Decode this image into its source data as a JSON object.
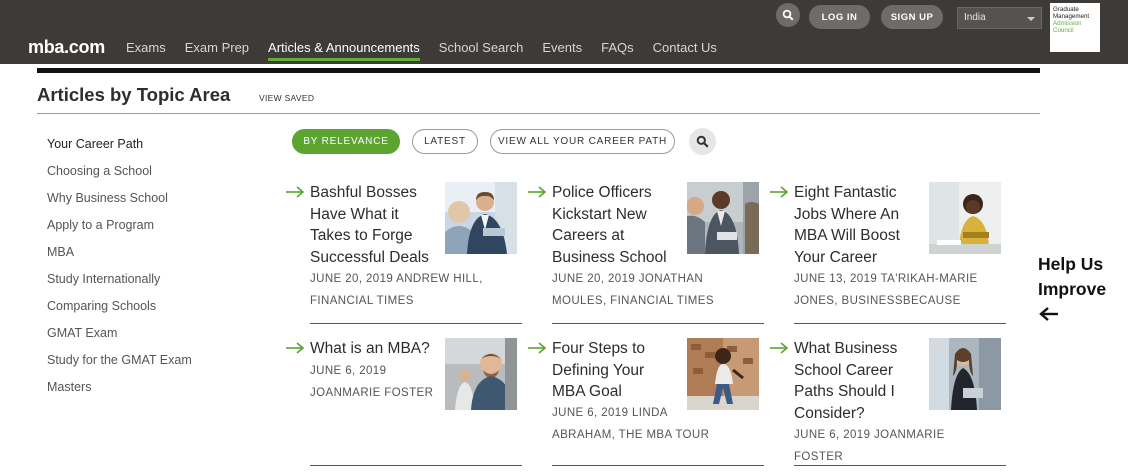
{
  "header": {
    "logo": "mba.com",
    "nav": [
      "Exams",
      "Exam Prep",
      "Articles & Announcements",
      "School Search",
      "Events",
      "FAQs",
      "Contact Us"
    ],
    "active_nav": "Articles & Announcements",
    "login_label": "LOG IN",
    "signup_label": "SIGN UP",
    "country_value": "India",
    "gmac_logo": {
      "line1": "Graduate",
      "line2": "Management",
      "line3": "Admission",
      "line4": "Council"
    }
  },
  "page": {
    "title": "Articles by Topic Area",
    "view_saved": "VIEW SAVED"
  },
  "sidebar": {
    "items": [
      "Your Career Path",
      "Choosing a School",
      "Why Business School",
      "Apply to a Program",
      "MBA",
      "Study Internationally",
      "Comparing Schools",
      "GMAT Exam",
      "Study for the GMAT Exam",
      "Masters"
    ]
  },
  "filters": {
    "relevance": "BY RELEVANCE",
    "latest": "LATEST",
    "view_all": "VIEW ALL YOUR CAREER PATH"
  },
  "articles": [
    {
      "title": [
        "Bashful Bosses",
        "Have What it",
        "Takes to Forge",
        "Successful Deals"
      ],
      "meta": [
        "JUNE 20, 2019 ANDREW HILL,",
        "FINANCIAL TIMES"
      ]
    },
    {
      "title": [
        "Police Officers",
        "Kickstart New",
        "Careers at",
        "Business School"
      ],
      "meta": [
        "JUNE 20, 2019 JONATHAN",
        "MOULES, FINANCIAL TIMES"
      ]
    },
    {
      "title": [
        "Eight Fantastic",
        "Jobs Where An",
        "MBA Will Boost",
        "Your Career"
      ],
      "meta": [
        "JUNE 13, 2019 TA'RIKAH-MARIE",
        "JONES, BUSINESSBECAUSE"
      ]
    },
    {
      "title": [
        "What is an MBA?"
      ],
      "meta": [
        "JUNE 6, 2019",
        "JOANMARIE FOSTER"
      ]
    },
    {
      "title": [
        "Four Steps to",
        "Defining Your",
        "MBA Goal"
      ],
      "meta": [
        "JUNE 6, 2019 LINDA",
        "ABRAHAM, THE MBA TOUR"
      ]
    },
    {
      "title": [
        "What Business",
        "School Career",
        "Paths Should I",
        "Consider?"
      ],
      "meta": [
        "JUNE 6, 2019 JOANMARIE FOSTER"
      ]
    }
  ],
  "help": {
    "line1": "Help Us",
    "line2": "Improve"
  },
  "colors": {
    "topbar": "#3e3a37",
    "accent_green": "#5ba430",
    "text": "#2d2d2d"
  }
}
